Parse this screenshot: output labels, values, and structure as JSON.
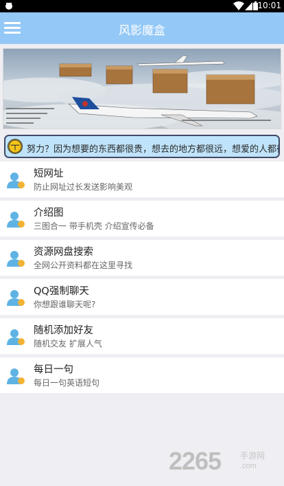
{
  "status_bar": {
    "time": "10:01"
  },
  "header": {
    "title": "风影魔盒"
  },
  "notice": {
    "text": "努力？因为想要的东西都很贵，想去的地方都很远，想爱的人都很优秀"
  },
  "list": [
    {
      "title": "短网址",
      "subtitle": "防止网址过长发送影响美观"
    },
    {
      "title": "介绍图",
      "subtitle": "三图合一 带手机壳 介绍宣传必备"
    },
    {
      "title": "资源网盘搜索",
      "subtitle": "全网公开资料都在这里寻找"
    },
    {
      "title": "QQ强制聊天",
      "subtitle": "你想跟谁聊天呢?"
    },
    {
      "title": "随机添加好友",
      "subtitle": "随机交友 扩展人气"
    },
    {
      "title": "每日一句",
      "subtitle": "每日一句英语短句"
    }
  ],
  "watermark": {
    "number": "2265",
    "cn": "手游网",
    "url": ".com"
  },
  "colors": {
    "app_bar": "#94c8f6",
    "notice_bg": "#bfe3fa",
    "avatar": "#5fb3e4",
    "badge": "#f2b233"
  }
}
